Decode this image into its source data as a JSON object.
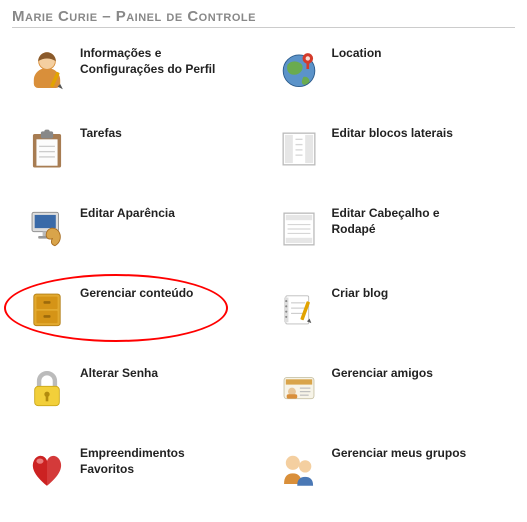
{
  "title": "Marie Curie – Painel de Controle",
  "items": [
    {
      "label": "Informações e Configurações do Perfil",
      "icon": "profile-icon"
    },
    {
      "label": "Location",
      "icon": "location-icon"
    },
    {
      "label": "Tarefas",
      "icon": "tasks-icon"
    },
    {
      "label": "Editar blocos laterais",
      "icon": "sideblocks-icon"
    },
    {
      "label": "Editar Aparência",
      "icon": "appearance-icon"
    },
    {
      "label": "Editar Cabeçalho e Rodapé",
      "icon": "headerfooter-icon"
    },
    {
      "label": "Gerenciar conteúdo",
      "icon": "content-icon",
      "highlighted": true
    },
    {
      "label": "Criar blog",
      "icon": "blog-icon"
    },
    {
      "label": "Alterar Senha",
      "icon": "password-icon"
    },
    {
      "label": "Gerenciar amigos",
      "icon": "friends-icon"
    },
    {
      "label": "Empreendimentos Favoritos",
      "icon": "favorites-icon"
    },
    {
      "label": "Gerenciar meus grupos",
      "icon": "groups-icon"
    }
  ]
}
